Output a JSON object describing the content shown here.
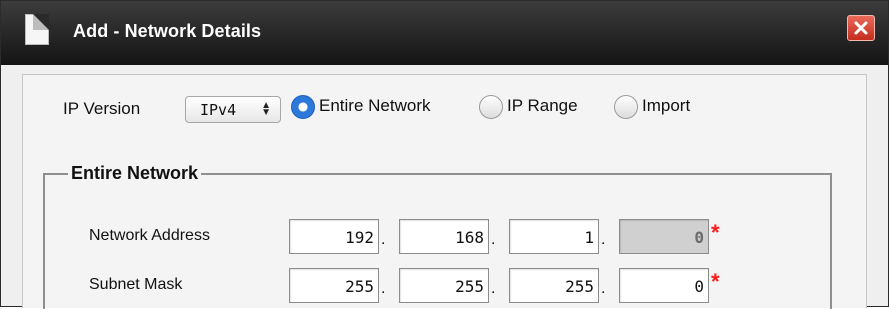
{
  "titlebar": {
    "title": "Add - Network Details"
  },
  "form": {
    "ip_version_label": "IP Version",
    "ip_version_value": "IPv4",
    "radio_entire": "Entire Network",
    "radio_range": "IP Range",
    "radio_import": "Import"
  },
  "fieldset": {
    "legend": "Entire Network",
    "network_address_label": "Network Address",
    "subnet_mask_label": "Subnet Mask",
    "network_address": [
      "192",
      "168",
      "1",
      "0"
    ],
    "subnet_mask": [
      "255",
      "255",
      "255",
      "0"
    ],
    "dot": ".",
    "required_mark": "*"
  },
  "colors": {
    "titlebar_bg": "#1f1f1f",
    "radio_selected": "#2c79db",
    "required": "#ff1a1a",
    "close_button": "#d9463a"
  },
  "icons": [
    "document-icon",
    "close-icon",
    "select-arrows-icon"
  ]
}
